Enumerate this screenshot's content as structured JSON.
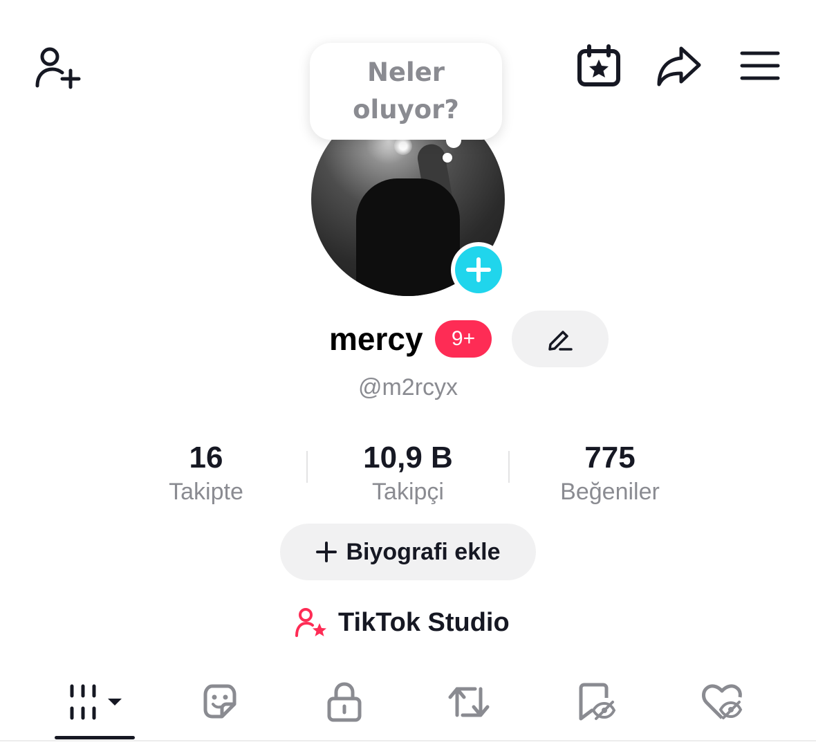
{
  "header": {
    "icons": [
      "add-friend-icon",
      "calendar-star-icon",
      "share-icon",
      "menu-icon"
    ]
  },
  "bubble": {
    "text": "Neler oluyor?"
  },
  "profile": {
    "name": "mercy",
    "notification_badge": "9+",
    "handle": "@m2rcyx"
  },
  "stats": [
    {
      "value": "16",
      "label": "Takipte"
    },
    {
      "value": "10,9 B",
      "label": "Takipçi"
    },
    {
      "value": "775",
      "label": "Beğeniler"
    }
  ],
  "bio_button": {
    "label": "Biyografi ekle"
  },
  "studio": {
    "label": "TikTok Studio"
  },
  "tabs": {
    "selected": 0,
    "items": [
      "videos-grid-icon",
      "sticker-icon",
      "lock-icon",
      "repost-icon",
      "bookmark-hidden-icon",
      "liked-hidden-icon"
    ]
  },
  "colors": {
    "accent_cyan": "#20d5ec",
    "accent_red": "#fe2c55",
    "text_primary": "#161823",
    "text_secondary": "#8a8b91",
    "button_bg": "#f1f1f2"
  }
}
